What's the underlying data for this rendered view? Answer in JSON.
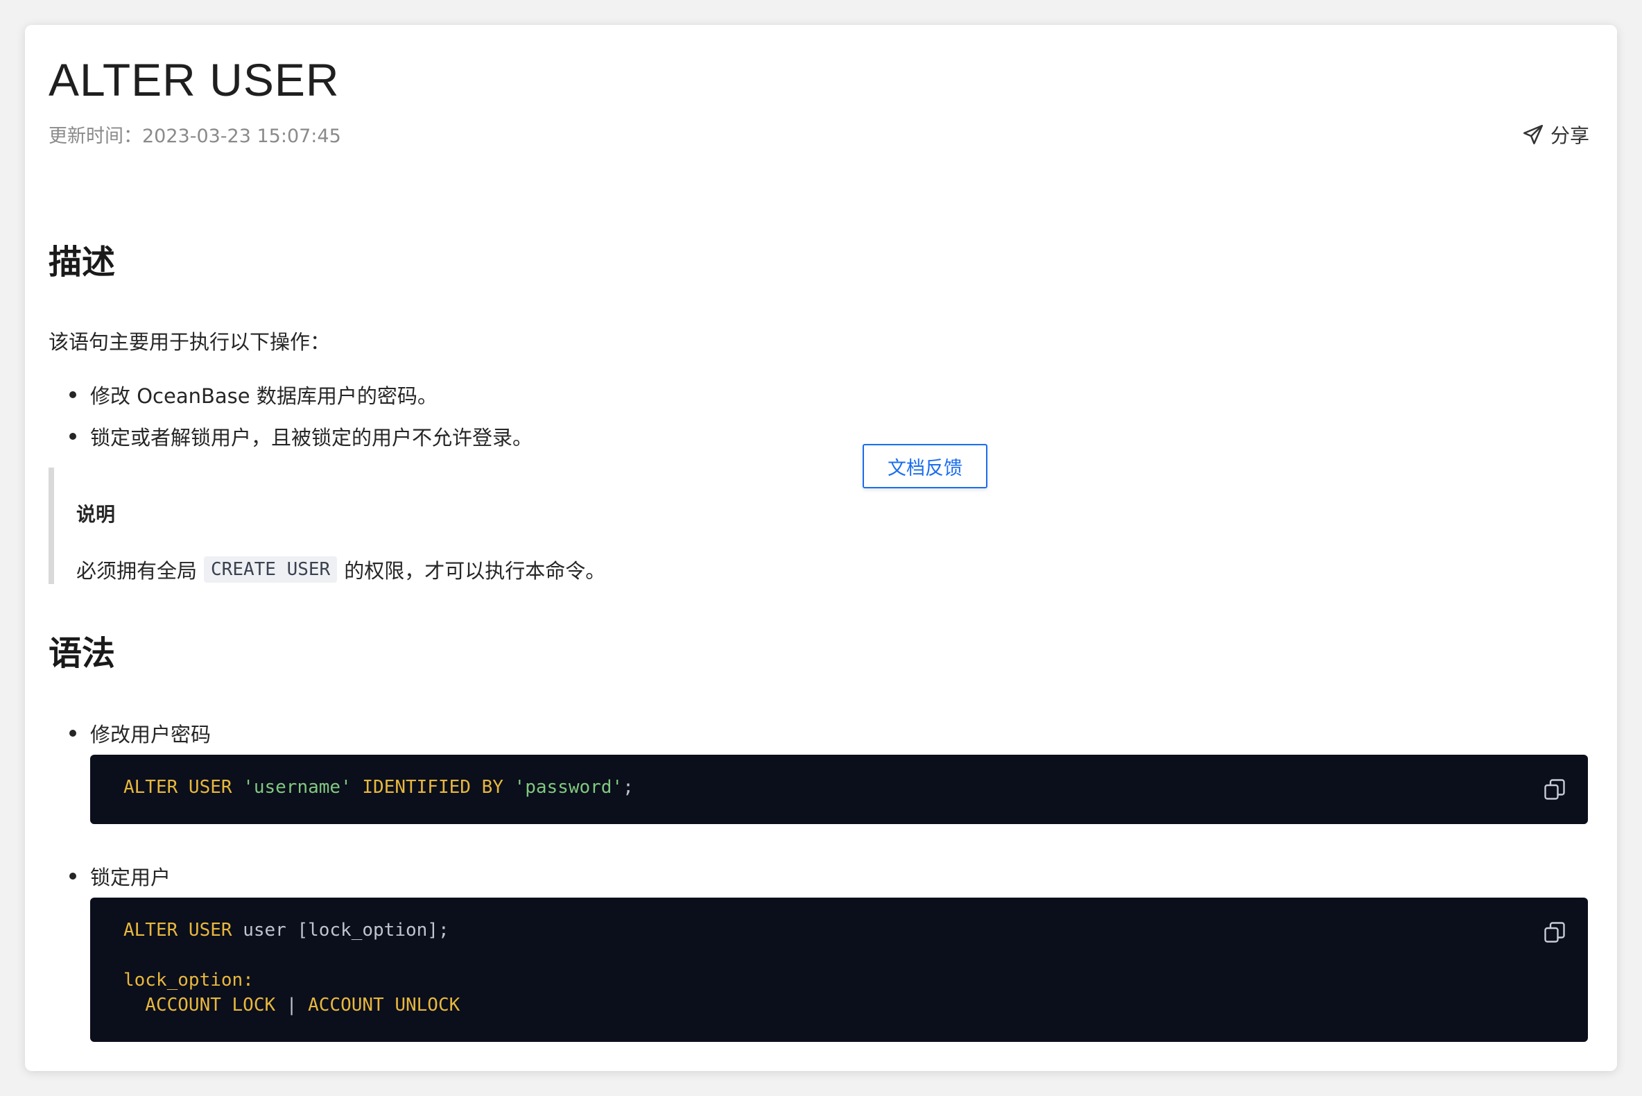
{
  "page": {
    "title": "ALTER USER",
    "updated_label": "更新时间：",
    "updated_value": "2023-03-23 15:07:45",
    "share_label": "分享",
    "feedback_label": "文档反馈"
  },
  "description": {
    "heading": "描述",
    "intro": "该语句主要用于执行以下操作：",
    "items": [
      "修改 OceanBase 数据库用户的密码。",
      "锁定或者解锁用户，且被锁定的用户不允许登录。"
    ]
  },
  "note": {
    "title": "说明",
    "before": "必须拥有全局",
    "code": "CREATE USER",
    "after": "的权限，才可以执行本命令。"
  },
  "syntax": {
    "heading": "语法",
    "item1": "修改用户密码",
    "code1": {
      "kw1": "ALTER USER ",
      "str1": "'username'",
      "kw2": " IDENTIFIED BY ",
      "str2": "'password'",
      "end": ";"
    },
    "item2": "锁定用户",
    "code2": {
      "l1_kw": "ALTER USER ",
      "l1_plain": "user [lock_option];",
      "l2": "lock_option:",
      "l3_a": "  ACCOUNT LOCK",
      "l3_sep": " | ",
      "l3_b": "ACCOUNT UNLOCK"
    }
  },
  "icons": {
    "share": "send-icon",
    "copy": "copy-icon"
  },
  "colors": {
    "accent": "#1a6df0",
    "code_bg": "#0b0e1b",
    "keyword": "#e8b83d",
    "string": "#7fc97f"
  }
}
